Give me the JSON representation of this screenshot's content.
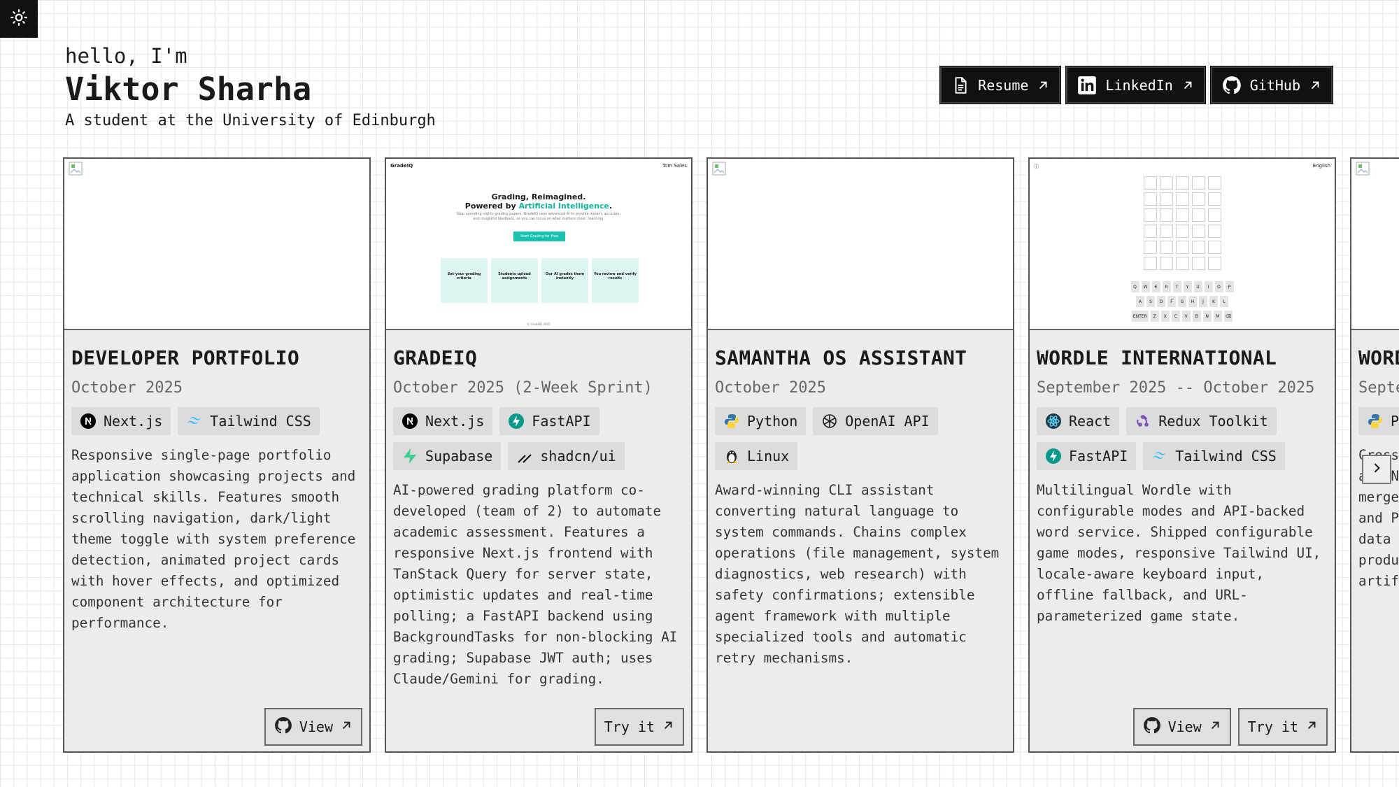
{
  "header": {
    "greeting": "hello, I'm",
    "name": "Viktor Sharha",
    "tagline": "A student at the University of Edinburgh"
  },
  "links": [
    {
      "label": "Resume",
      "icon": "file-icon"
    },
    {
      "label": "LinkedIn",
      "icon": "linkedin-icon"
    },
    {
      "label": "GitHub",
      "icon": "github-icon"
    }
  ],
  "projects": [
    {
      "title": "DEVELOPER PORTFOLIO",
      "date": "October 2025",
      "tags": [
        "Next.js",
        "Tailwind CSS"
      ],
      "description": "Responsive single-page portfolio application showcasing projects and technical skills. Features smooth scrolling navigation, dark/light theme toggle with system preference detection, animated project cards with hover effects, and optimized component architecture for performance.",
      "actions": [
        "View"
      ]
    },
    {
      "title": "GRADEIQ",
      "date": "October 2025 (2-Week Sprint)",
      "tags": [
        "Next.js",
        "FastAPI",
        "Supabase",
        "shadcn/ui"
      ],
      "description": "AI-powered grading platform co-developed (team of 2) to automate academic assessment. Features a responsive Next.js frontend with TanStack Query for server state, optimistic updates and real-time polling; a FastAPI backend using BackgroundTasks for non-blocking AI grading; Supabase JWT auth; uses Claude/Gemini for grading.",
      "actions": [
        "Try it"
      ],
      "thumb": {
        "brand": "GradeIQ",
        "user": "Tom Sales",
        "title_line1": "Grading, Reimagined.",
        "title_line2_prefix": "Powered by ",
        "title_line2_accent": "Artificial Intelligence",
        "title_line2_suffix": ".",
        "subtitle": "Stop spending nights grading papers. GradeIQ uses advanced AI to provide instant, accurate, and insightful feedback, so you can focus on what matters most: teaching.",
        "cta": "Start Grading for Free",
        "steps": [
          "Set your grading criteria",
          "Students upload assignments",
          "Our AI grades them instantly",
          "You review and verify results"
        ],
        "footer": "© GradeIQ 2025"
      }
    },
    {
      "title": "SAMANTHA OS ASSISTANT",
      "date": "October 2025",
      "tags": [
        "Python",
        "OpenAI API",
        "Linux"
      ],
      "description": "Award-winning CLI assistant converting natural language to system commands. Chains complex operations (file management, system diagnostics, web research) with safety confirmations; extensible agent framework with multiple specialized tools and automatic retry mechanisms.",
      "actions": []
    },
    {
      "title": "WORDLE INTERNATIONAL",
      "date": "September 2025 -- October 2025",
      "tags": [
        "React",
        "Redux Toolkit",
        "FastAPI",
        "Tailwind CSS"
      ],
      "description": "Multilingual Wordle with configurable modes and API-backed word service. Shipped configurable game modes, responsive Tailwind UI, locale-aware keyboard input, offline fallback, and URL-parameterized game state.",
      "actions": [
        "View",
        "Try it"
      ],
      "thumb": {
        "language": "English",
        "keyboard": [
          [
            "Q",
            "W",
            "E",
            "R",
            "T",
            "Y",
            "U",
            "I",
            "O",
            "P"
          ],
          [
            "A",
            "S",
            "D",
            "F",
            "G",
            "H",
            "J",
            "K",
            "L"
          ],
          [
            "ENTER",
            "Z",
            "X",
            "C",
            "V",
            "B",
            "N",
            "M",
            "⌫"
          ]
        ]
      }
    },
    {
      "title": "WORD",
      "date": "Septe",
      "tags": [
        "Py"
      ],
      "description_lines": [
        "Cross",
        "and NL",
        "merge",
        "and PD",
        "data w",
        "produc",
        "artif"
      ]
    }
  ],
  "colors": {
    "accent": "#15b5a5",
    "dark": "#111111",
    "card_bg": "#ececec",
    "tag_bg": "#dcdcdc"
  }
}
